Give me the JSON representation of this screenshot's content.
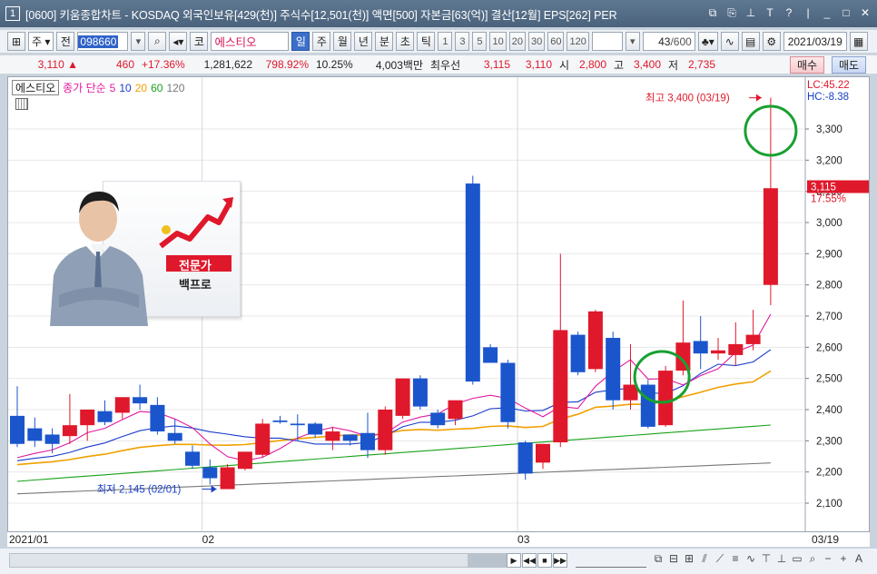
{
  "window": {
    "number": "1",
    "title": "[0600] 키움종합차트 - KOSDAQ 외국인보유[429(천)] 주식수[12,501(천)] 액면[500] 자본금[63(억)] 결산[12월] EPS[262] PER",
    "icons": [
      "restore-icon",
      "copy-icon",
      "pin-icon",
      "font-icon",
      "help-icon",
      "separator",
      "minimize-icon",
      "maximize-icon",
      "close-icon"
    ]
  },
  "toolbar": {
    "period_select": "주",
    "prev_label": "전",
    "code": "098660",
    "market_tag": "코",
    "stock_name": "에스티오",
    "timeframes": [
      "일",
      "주",
      "월",
      "년",
      "분",
      "초",
      "틱"
    ],
    "active_timeframe": "일",
    "intervals": [
      "1",
      "3",
      "5",
      "10",
      "20",
      "30",
      "60",
      "120"
    ],
    "count": "43",
    "count_total": "/600",
    "date": "2021/03/19"
  },
  "infobar": {
    "price": "3,110",
    "change": "460",
    "change_pct": "+17.36%",
    "volume": "1,281,622",
    "volume_pct": "798.92%",
    "turnover": "10.25%",
    "amount": "4,003백만",
    "best_ask_label": "최우선",
    "best_ask": "3,115",
    "best_bid": "3,110",
    "open_label": "시",
    "open": "2,800",
    "high_label": "고",
    "high": "3,400",
    "low_label": "저",
    "low": "2,735",
    "buy_label": "매수",
    "sell_label": "매도"
  },
  "legend": {
    "stock": "에스티오",
    "price_label": "종가 단순",
    "ma": [
      {
        "period": "5",
        "color": "#e01aa0"
      },
      {
        "period": "10",
        "color": "#1a3ccc"
      },
      {
        "period": "20",
        "color": "#f0a000"
      },
      {
        "period": "60",
        "color": "#18a018"
      },
      {
        "period": "120",
        "color": "#777777"
      }
    ]
  },
  "banner": {
    "line1": "전문가",
    "line2": "백프로"
  },
  "chart_data": {
    "type": "candlestick",
    "y_ticks": [
      2100,
      2200,
      2300,
      2400,
      2500,
      2600,
      2700,
      2800,
      2900,
      3000,
      3100,
      3200,
      3300
    ],
    "ylim": [
      2050,
      3450
    ],
    "lc_label": "LC:45.22",
    "hc_label": "HC:-8.38",
    "current_price_label": "3,115",
    "current_pct_label": "17.55%",
    "high_annotation": "최고 3,400 (03/19)",
    "low_annotation": "최저 2,145 (02/01)",
    "x_labels": [
      {
        "label": "2021/01",
        "index": 0
      },
      {
        "label": "02",
        "index": 11
      },
      {
        "label": "03",
        "index": 29
      }
    ],
    "x_end_label": "03/19",
    "candles": [
      {
        "o": 2380,
        "h": 2475,
        "l": 2280,
        "c": 2290
      },
      {
        "o": 2340,
        "h": 2375,
        "l": 2280,
        "c": 2300
      },
      {
        "o": 2320,
        "h": 2340,
        "l": 2260,
        "c": 2290
      },
      {
        "o": 2315,
        "h": 2450,
        "l": 2290,
        "c": 2350
      },
      {
        "o": 2350,
        "h": 2400,
        "l": 2300,
        "c": 2400
      },
      {
        "o": 2395,
        "h": 2430,
        "l": 2350,
        "c": 2360
      },
      {
        "o": 2390,
        "h": 2440,
        "l": 2370,
        "c": 2440
      },
      {
        "o": 2440,
        "h": 2480,
        "l": 2400,
        "c": 2420
      },
      {
        "o": 2415,
        "h": 2440,
        "l": 2320,
        "c": 2330
      },
      {
        "o": 2325,
        "h": 2370,
        "l": 2290,
        "c": 2300
      },
      {
        "o": 2265,
        "h": 2285,
        "l": 2210,
        "c": 2220
      },
      {
        "o": 2215,
        "h": 2240,
        "l": 2160,
        "c": 2180
      },
      {
        "o": 2145,
        "h": 2225,
        "l": 2145,
        "c": 2215
      },
      {
        "o": 2210,
        "h": 2265,
        "l": 2205,
        "c": 2265
      },
      {
        "o": 2255,
        "h": 2370,
        "l": 2245,
        "c": 2355
      },
      {
        "o": 2365,
        "h": 2380,
        "l": 2355,
        "c": 2360
      },
      {
        "o": 2355,
        "h": 2385,
        "l": 2300,
        "c": 2350
      },
      {
        "o": 2355,
        "h": 2360,
        "l": 2310,
        "c": 2320
      },
      {
        "o": 2300,
        "h": 2345,
        "l": 2270,
        "c": 2330
      },
      {
        "o": 2320,
        "h": 2320,
        "l": 2285,
        "c": 2300
      },
      {
        "o": 2325,
        "h": 2390,
        "l": 2245,
        "c": 2270
      },
      {
        "o": 2270,
        "h": 2410,
        "l": 2255,
        "c": 2400
      },
      {
        "o": 2380,
        "h": 2500,
        "l": 2370,
        "c": 2500
      },
      {
        "o": 2500,
        "h": 2510,
        "l": 2400,
        "c": 2410
      },
      {
        "o": 2390,
        "h": 2400,
        "l": 2340,
        "c": 2350
      },
      {
        "o": 2370,
        "h": 2430,
        "l": 2350,
        "c": 2430
      },
      {
        "o": 3125,
        "h": 3150,
        "l": 2480,
        "c": 2490
      },
      {
        "o": 2600,
        "h": 2610,
        "l": 2550,
        "c": 2550
      },
      {
        "o": 2550,
        "h": 2560,
        "l": 2340,
        "c": 2360
      },
      {
        "o": 2295,
        "h": 2300,
        "l": 2175,
        "c": 2195
      },
      {
        "o": 2230,
        "h": 2290,
        "l": 2210,
        "c": 2290
      },
      {
        "o": 2295,
        "h": 2900,
        "l": 2280,
        "c": 2655
      },
      {
        "o": 2640,
        "h": 2650,
        "l": 2510,
        "c": 2520
      },
      {
        "o": 2530,
        "h": 2720,
        "l": 2520,
        "c": 2715
      },
      {
        "o": 2630,
        "h": 2650,
        "l": 2400,
        "c": 2430
      },
      {
        "o": 2430,
        "h": 2610,
        "l": 2400,
        "c": 2480
      },
      {
        "o": 2480,
        "h": 2495,
        "l": 2340,
        "c": 2345
      },
      {
        "o": 2350,
        "h": 2540,
        "l": 2345,
        "c": 2525
      },
      {
        "o": 2525,
        "h": 2750,
        "l": 2510,
        "c": 2615
      },
      {
        "o": 2620,
        "h": 2700,
        "l": 2530,
        "c": 2580
      },
      {
        "o": 2580,
        "h": 2630,
        "l": 2560,
        "c": 2590
      },
      {
        "o": 2575,
        "h": 2680,
        "l": 2540,
        "c": 2610
      },
      {
        "o": 2610,
        "h": 2720,
        "l": 2590,
        "c": 2640
      },
      {
        "o": 2800,
        "h": 3400,
        "l": 2735,
        "c": 3110
      }
    ]
  }
}
